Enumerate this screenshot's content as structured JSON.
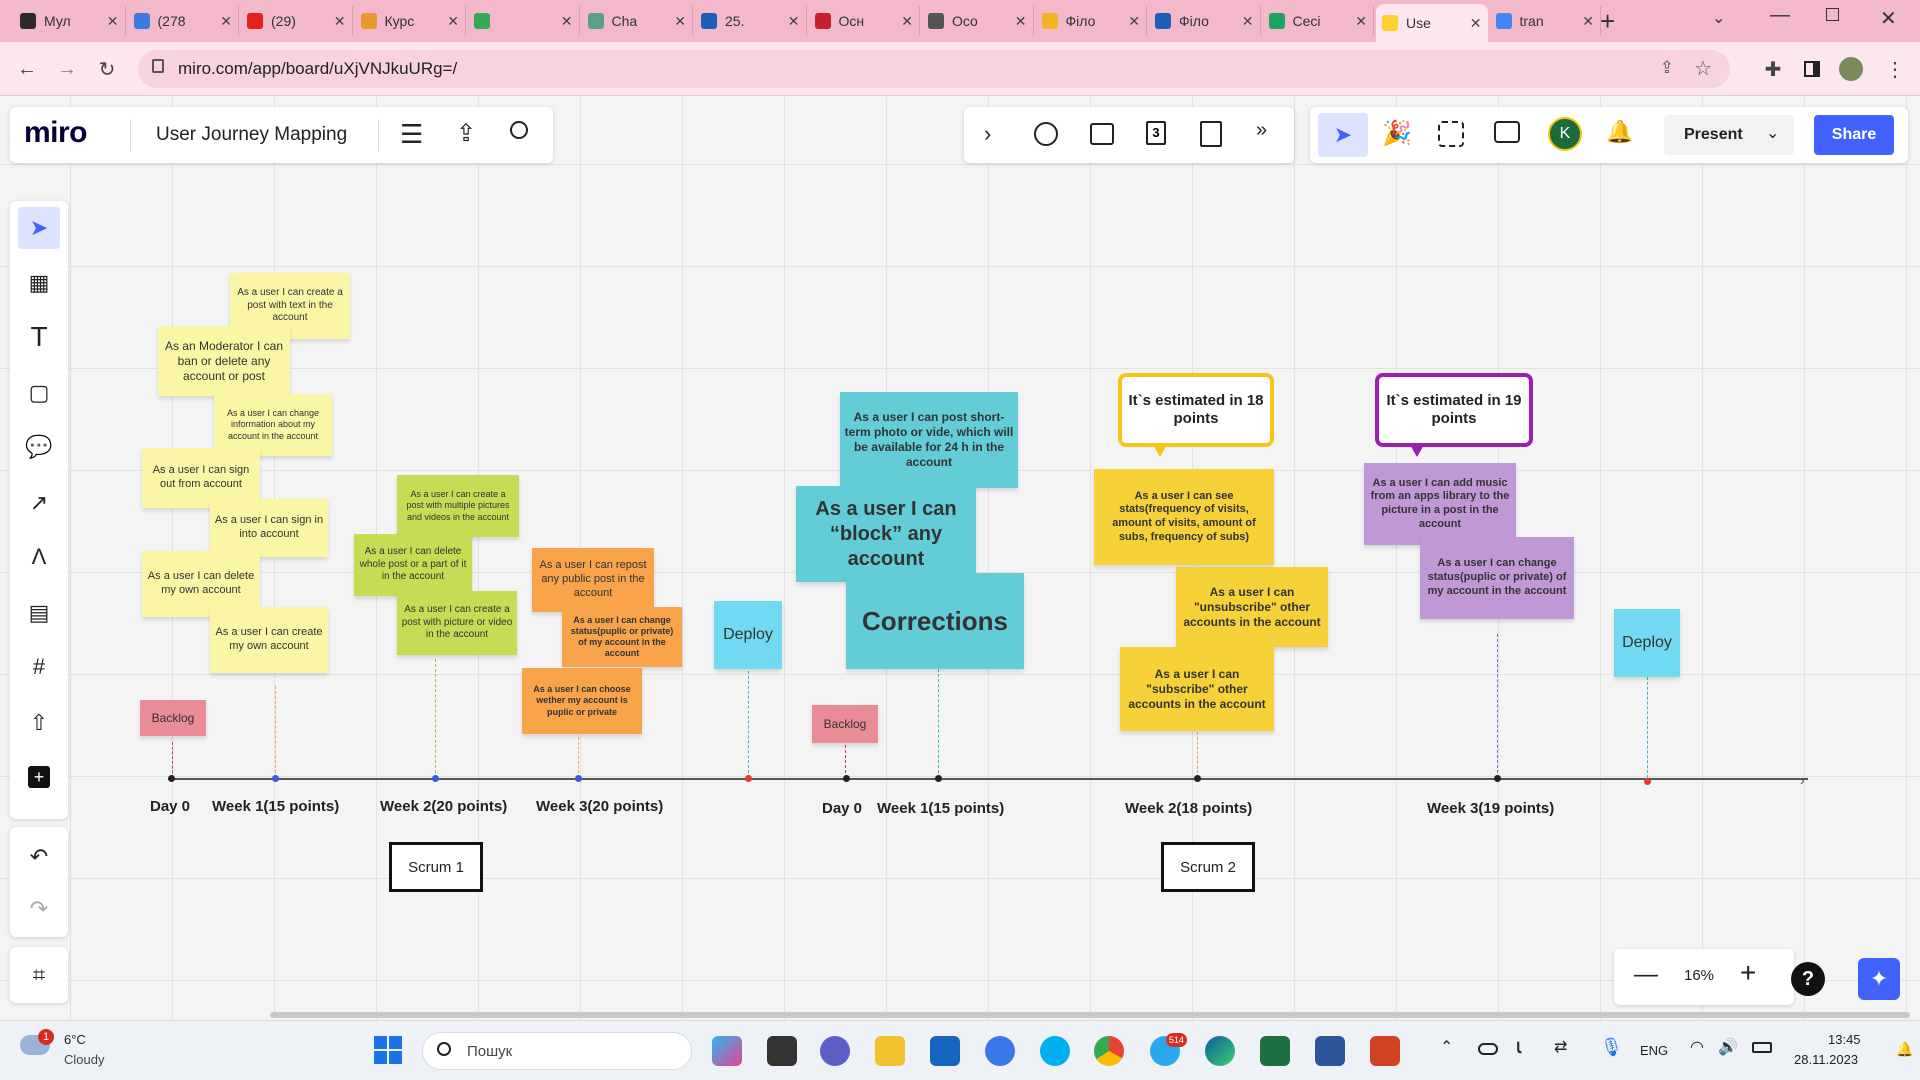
{
  "browser": {
    "tabs": [
      {
        "label": "Мул",
        "color": "#2b2b2b"
      },
      {
        "label": "(278",
        "color": "#3b7be0"
      },
      {
        "label": "(29)",
        "color": "#e62117"
      },
      {
        "label": "Курс",
        "color": "#e59a2b"
      },
      {
        "label": "",
        "color": "#34a853"
      },
      {
        "label": "Cha",
        "color": "#5a9e8c"
      },
      {
        "label": "25.",
        "color": "#1d5fb8"
      },
      {
        "label": "Осн",
        "color": "#c8202f"
      },
      {
        "label": "Осо",
        "color": "#555555"
      },
      {
        "label": "Філо",
        "color": "#f0b429"
      },
      {
        "label": "Філо",
        "color": "#1d5fb8"
      },
      {
        "label": "Сесі",
        "color": "#1ea362"
      },
      {
        "label": "Use",
        "color": "#ffd02f"
      },
      {
        "label": "tran",
        "color": "#4285f4"
      }
    ],
    "url": "miro.com/app/board/uXjVNJkuURg=/"
  },
  "miro": {
    "logo": "miro",
    "board_title": "User Journey Mapping",
    "present_label": "Present",
    "share_label": "Share",
    "avatar_letter": "K",
    "zoom": "16%",
    "help": "?"
  },
  "stickies": {
    "s1": "As a user I can create a post with text in the account",
    "s2": "As an Moderator I can ban or delete any account or post",
    "s3": "As a user I can change information about my account in the account",
    "s4": "As a user I can sign out from account",
    "s5": "As a user I can sign in into account",
    "s6": "As a user I can delete my own account",
    "s7": "As a user I can create my own account",
    "backlog1": "Backlog",
    "w2a": "As a user I can create a post with multiple pictures and videos in the account",
    "w2b": "As a user I can delete whole post or a part of it in the account",
    "w2c": "As a user I can create a post with picture or video in the account",
    "w3a": "As a user I can repost any public post in the account",
    "w3b": "As a user I can change status(puplic or private) of my account in the account",
    "w3c": "As a user I can choose wether my account is puplic or private",
    "deploy1": "Deploy",
    "backlog2": "Backlog",
    "t1": "As a user I can post short-term photo or vide, which will be available for 24 h in the account",
    "t2": "As a user I can “block” any account",
    "t3": "Corrections",
    "y1": "As a user I can see stats(frequency of visits, amount of visits, amount of subs, frequency of subs)",
    "y2": "As a user I can \"unsubscribe\" other accounts in the account",
    "y3": "As a user I can \"subscribe\" other accounts in the account",
    "p1": "As a user I can add music from an apps library to the picture in a post in the account",
    "p2": "As a user I can change status(puplic or private) of my account in the account",
    "deploy2": "Deploy"
  },
  "bubbles": {
    "b1": "It`s estimated in 18 points",
    "b2": "It`s estimated in 19 points"
  },
  "timeline": {
    "labels": [
      "Day 0",
      "Week 1(15 points)",
      "Week 2(20 points)",
      "Week 3(20 points)",
      "Day 0",
      "Week 1(15 points)",
      "Week 2(18 points)",
      "Week 3(19 points)"
    ],
    "scrum1": "Scrum 1",
    "scrum2": "Scrum 2"
  },
  "taskbar": {
    "temp": "6°C",
    "weather": "Cloudy",
    "weather_badge": "1",
    "search": "Пошук",
    "lang": "ENG",
    "time": "13:45",
    "date": "28.11.2023",
    "telegram_badge": "514"
  },
  "colors": {
    "sticky_yellow": "#fbf5a6",
    "sticky_green": "#c5dc54",
    "sticky_orange": "#f9a34b",
    "sticky_cyan": "#62cdd7",
    "sticky_blue": "#72d9f3",
    "sticky_pink": "#ea8c96",
    "sticky_gold": "#f7d138",
    "sticky_violet": "#be99d6",
    "accent_blue": "#4262ff",
    "bubble_yellow": "#f5c518",
    "bubble_violet": "#9b1fb1"
  }
}
